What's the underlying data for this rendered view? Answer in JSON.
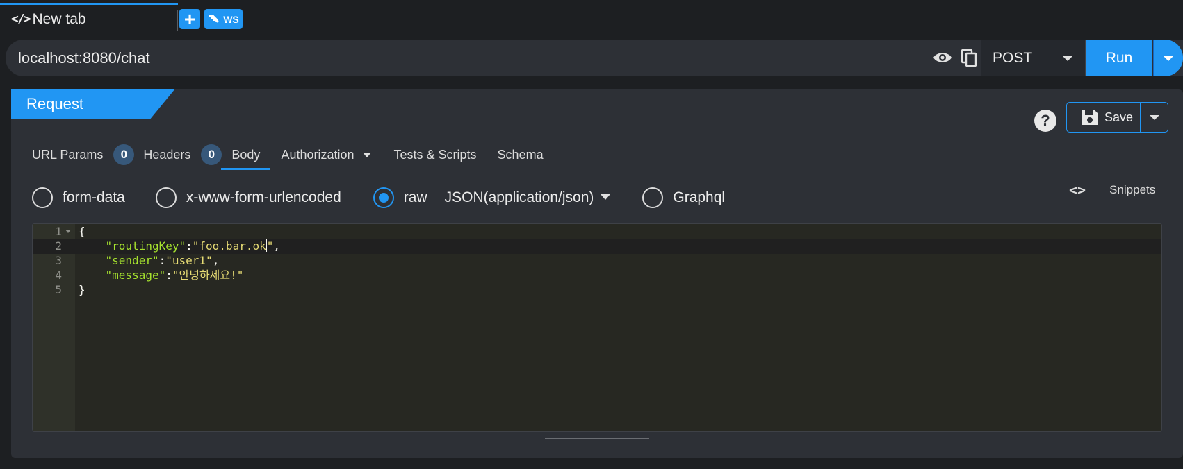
{
  "tabs": {
    "active_tab_label": "New tab",
    "ws_label": "WS"
  },
  "urlbar": {
    "url": "localhost:8080/chat",
    "method": "POST",
    "run_label": "Run"
  },
  "request": {
    "header": "Request",
    "save_label": "Save",
    "help_glyph": "?",
    "subtabs": {
      "url_params": "URL Params",
      "url_params_count": "0",
      "headers": "Headers",
      "headers_count": "0",
      "body": "Body",
      "authorization": "Authorization",
      "tests": "Tests & Scripts",
      "schema": "Schema"
    },
    "body_types": {
      "form_data": "form-data",
      "urlencoded": "x-www-form-urlencoded",
      "raw": "raw",
      "raw_format": "JSON(application/json)",
      "graphql": "Graphql",
      "selected": "raw"
    },
    "snippets_label": "Snippets"
  },
  "editor": {
    "line_numbers": [
      "1",
      "2",
      "3",
      "4",
      "5"
    ],
    "active_line": 2,
    "lines": {
      "l1": "{",
      "l2_key": "\"routingKey\"",
      "l2_val_a": "\"foo.bar.ok",
      "l2_val_b": "\"",
      "l3_key": "\"sender\"",
      "l3_val": "\"user1\"",
      "l4_key": "\"message\"",
      "l4_val": "\"안녕하세요!\"",
      "l5": "}"
    }
  },
  "colors": {
    "accent": "#2196f3",
    "panel": "#2d3036",
    "background": "#1d1f22",
    "editor_bg": "#272822"
  }
}
